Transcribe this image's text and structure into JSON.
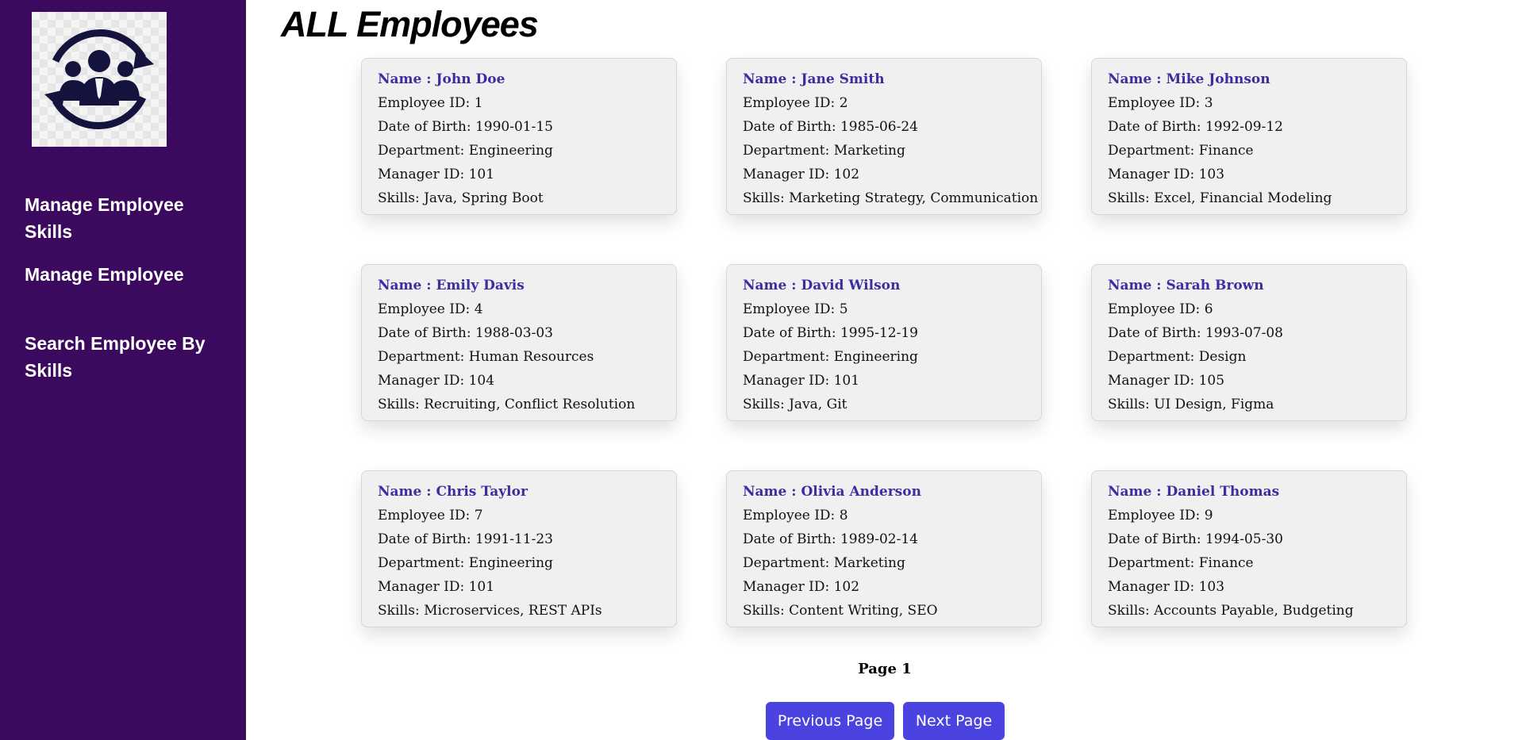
{
  "sidebar": {
    "logo_icon": "employee-group-cycle-icon",
    "nav": [
      {
        "label": "Manage Employee Skills"
      },
      {
        "label": "Manage Employee"
      },
      {
        "label": "Search Employee By Skills"
      }
    ]
  },
  "main": {
    "title": "ALL Employees",
    "employees": [
      {
        "name": "Name : John Doe",
        "id": "Employee ID: 1",
        "dob": "Date of Birth: 1990-01-15",
        "department": "Department: Engineering",
        "manager": "Manager ID: 101",
        "skills": "Skills: Java, Spring Boot"
      },
      {
        "name": "Name : Jane Smith",
        "id": "Employee ID: 2",
        "dob": "Date of Birth: 1985-06-24",
        "department": "Department: Marketing",
        "manager": "Manager ID: 102",
        "skills": "Skills: Marketing Strategy, Communication"
      },
      {
        "name": "Name : Mike Johnson",
        "id": "Employee ID: 3",
        "dob": "Date of Birth: 1992-09-12",
        "department": "Department: Finance",
        "manager": "Manager ID: 103",
        "skills": "Skills: Excel, Financial Modeling"
      },
      {
        "name": "Name : Emily Davis",
        "id": "Employee ID: 4",
        "dob": "Date of Birth: 1988-03-03",
        "department": "Department: Human Resources",
        "manager": "Manager ID: 104",
        "skills": "Skills: Recruiting, Conflict Resolution"
      },
      {
        "name": "Name : David Wilson",
        "id": "Employee ID: 5",
        "dob": "Date of Birth: 1995-12-19",
        "department": "Department: Engineering",
        "manager": "Manager ID: 101",
        "skills": "Skills: Java, Git"
      },
      {
        "name": "Name : Sarah Brown",
        "id": "Employee ID: 6",
        "dob": "Date of Birth: 1993-07-08",
        "department": "Department: Design",
        "manager": "Manager ID: 105",
        "skills": "Skills: UI Design, Figma"
      },
      {
        "name": "Name : Chris Taylor",
        "id": "Employee ID: 7",
        "dob": "Date of Birth: 1991-11-23",
        "department": "Department: Engineering",
        "manager": "Manager ID: 101",
        "skills": "Skills: Microservices, REST APIs"
      },
      {
        "name": "Name : Olivia Anderson",
        "id": "Employee ID: 8",
        "dob": "Date of Birth: 1989-02-14",
        "department": "Department: Marketing",
        "manager": "Manager ID: 102",
        "skills": "Skills: Content Writing, SEO"
      },
      {
        "name": "Name : Daniel Thomas",
        "id": "Employee ID: 9",
        "dob": "Date of Birth: 1994-05-30",
        "department": "Department: Finance",
        "manager": "Manager ID: 103",
        "skills": "Skills: Accounts Payable, Budgeting"
      }
    ],
    "pagination": {
      "page_label": "Page 1",
      "prev_label": "Previous Page",
      "next_label": "Next Page"
    }
  },
  "colors": {
    "sidebar_bg": "#3b0a5e",
    "name_text": "#3b2ea0",
    "button_bg": "#4a43e0",
    "card_bg": "#f0f0f0"
  }
}
